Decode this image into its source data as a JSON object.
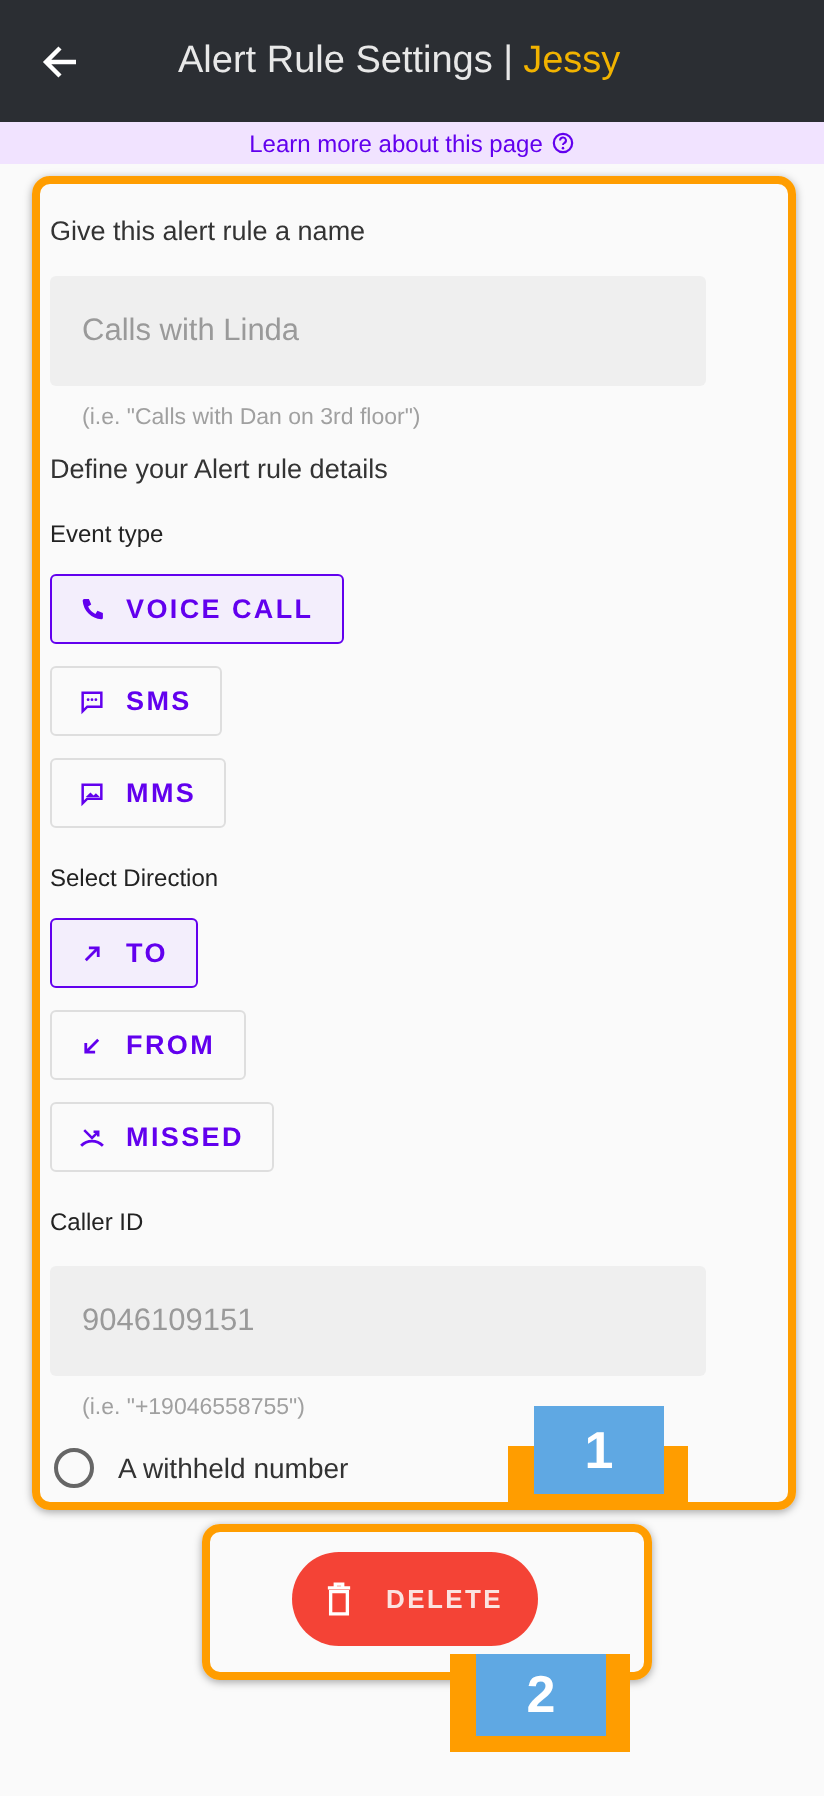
{
  "header": {
    "title": "Alert Rule Settings |",
    "name": "Jessy"
  },
  "banner": {
    "link": "Learn more about this page"
  },
  "form": {
    "name_label": "Give this alert rule a name",
    "name_field": {
      "placeholder": "Calls with Linda",
      "hint": "(i.e. \"Calls with Dan on 3rd floor\")"
    },
    "details_label": "Define your Alert rule details",
    "event_label": "Event type",
    "event_types": [
      {
        "label": "VOICE CALL",
        "kind": "phone",
        "selected": true
      },
      {
        "label": "SMS",
        "kind": "chat",
        "selected": false
      },
      {
        "label": "MMS",
        "kind": "image",
        "selected": false
      }
    ],
    "direction_label": "Select Direction",
    "directions": [
      {
        "label": "TO",
        "kind": "outgoing",
        "selected": true
      },
      {
        "label": "FROM",
        "kind": "incoming",
        "selected": false
      },
      {
        "label": "MISSED",
        "kind": "missed",
        "selected": false
      }
    ],
    "caller_label": "Caller ID",
    "caller_field": {
      "placeholder": "9046109151",
      "hint": "(i.e. \"+19046558755\")"
    },
    "withheld": {
      "label": "A withheld number",
      "checked": false
    }
  },
  "delete_button": {
    "label": "DELETE"
  },
  "annotations": [
    {
      "label": "1"
    },
    {
      "label": "2"
    }
  ]
}
